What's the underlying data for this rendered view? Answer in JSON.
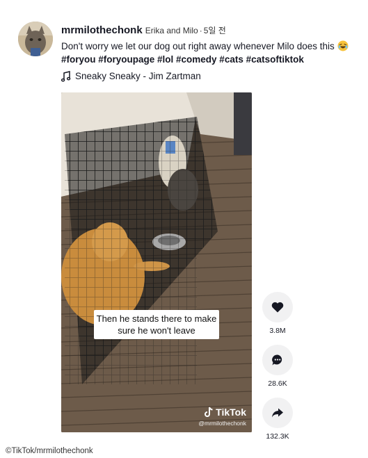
{
  "post": {
    "username": "mrmilothechonk",
    "nickname": "Erika and Milo",
    "time": "5일 전",
    "caption_text": "Don't worry we let our dog out right away whenever Milo does this",
    "emoji_icon": "laughing-emoji-icon",
    "hashtags": "#foryou #foryoupage #lol #comedy #cats #catsoftiktok",
    "music": "Sneaky Sneaky - Jim Zartman"
  },
  "video": {
    "subtitle": "Then he stands there to make sure he won't leave",
    "watermark_logo": "TikTok",
    "watermark_handle": "@mrmilothechonk"
  },
  "actions": {
    "like_count": "3.8M",
    "comment_count": "28.6K",
    "share_count": "132.3K"
  },
  "credit": "©TikTok/mrmilothechonk"
}
